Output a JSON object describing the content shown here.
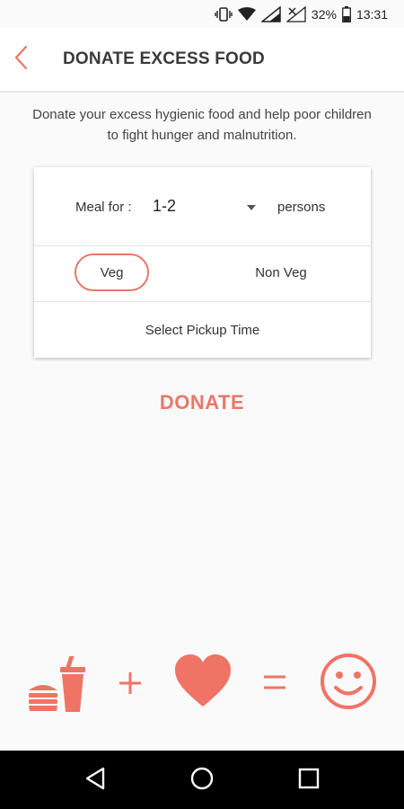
{
  "status_bar": {
    "battery": "32%",
    "time": "13:31",
    "icons": [
      "vibrate-icon",
      "wifi-icon",
      "signal-icon",
      "no-sim-icon",
      "battery-icon"
    ]
  },
  "header": {
    "title": "DONATE EXCESS FOOD",
    "back_icon": "chevron-left-icon"
  },
  "intro_text": "Donate your excess hygienic food and help poor children to fight hunger and malnutrition.",
  "form": {
    "meal_label": "Meal for :",
    "meal_value": "1-2",
    "persons_label": "persons",
    "veg_label": "Veg",
    "non_veg_label": "Non Veg",
    "selected_food_type": "Veg",
    "pickup_label": "Select Pickup Time"
  },
  "donate_label": "DONATE",
  "equation": {
    "items": [
      "burger-drink-icon",
      "plus-icon",
      "heart-icon",
      "equals-icon",
      "smiley-icon"
    ]
  },
  "navigation": {
    "icons": [
      "back-triangle-icon",
      "home-circle-icon",
      "recents-square-icon"
    ]
  },
  "colors": {
    "accent": "#e8776b",
    "background": "#fafafa",
    "nav_bar": "#000000"
  }
}
